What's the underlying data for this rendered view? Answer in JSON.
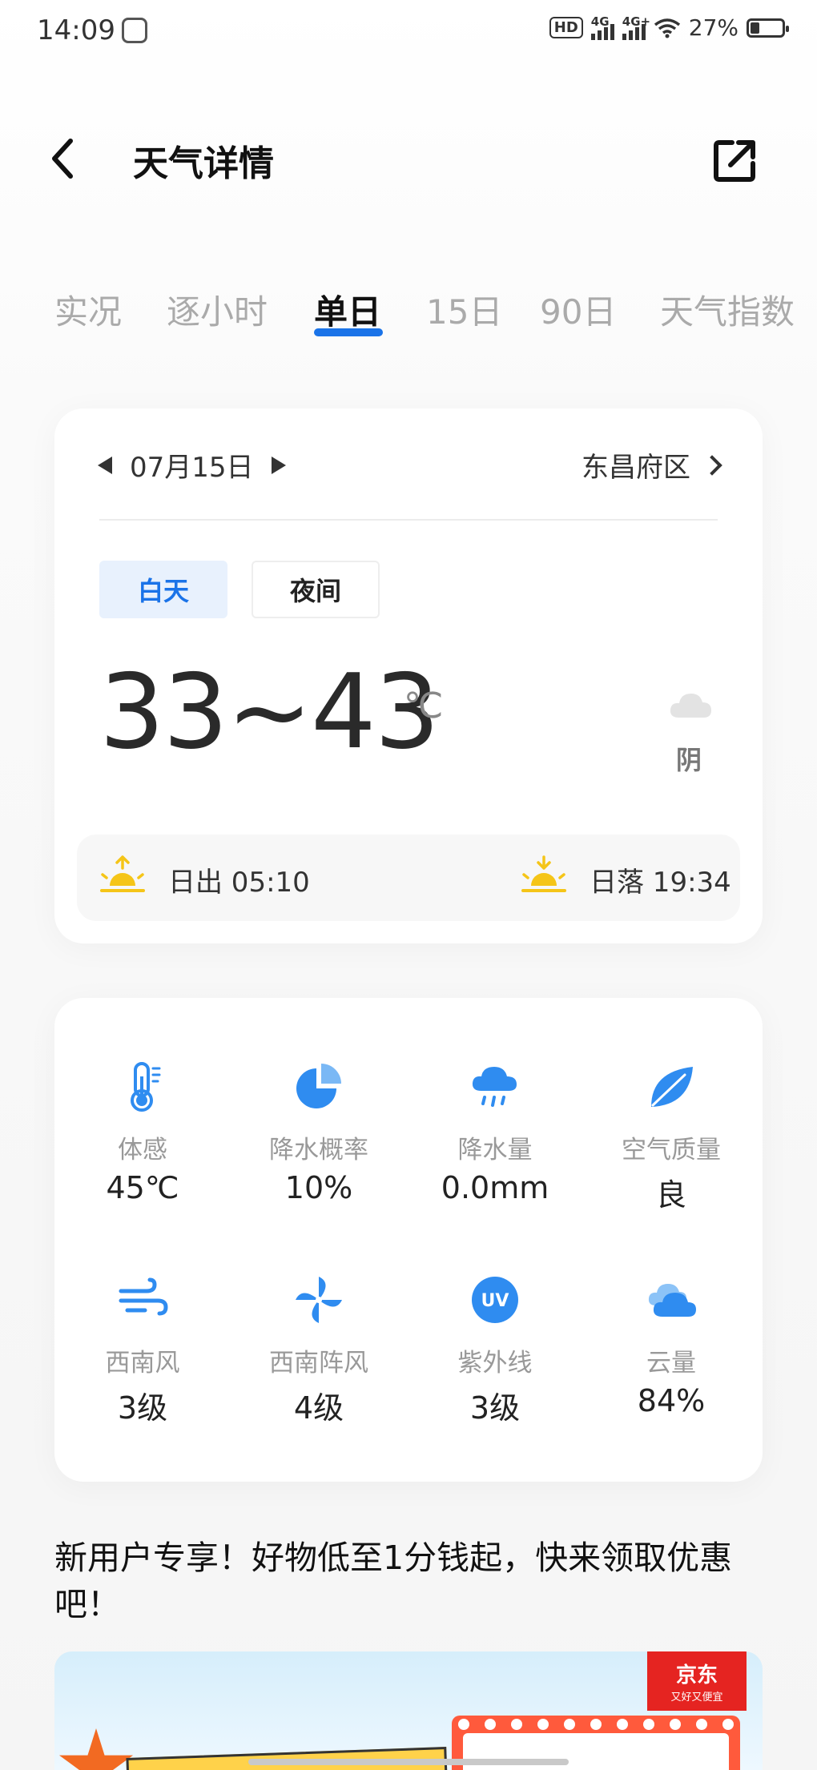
{
  "status_bar": {
    "time": "14:09",
    "hd_badge": "HD",
    "sim1_label": "4G",
    "sim2_label": "4G+",
    "battery_text": "27%",
    "battery_level_percent": 27
  },
  "header": {
    "title": "天气详情",
    "back_icon": "back-arrow-icon",
    "share_icon": "share-external-icon"
  },
  "tabs": [
    {
      "label": "实况",
      "active": false
    },
    {
      "label": "逐小时",
      "active": false
    },
    {
      "label": "单日",
      "active": true
    },
    {
      "label": "15日",
      "active": false
    },
    {
      "label": "90日",
      "active": false
    },
    {
      "label": "天气指数",
      "active": false
    }
  ],
  "day_card": {
    "date": "07月15日",
    "location": "东昌府区",
    "segments": {
      "day": "白天",
      "night": "夜间",
      "selected": "白天"
    },
    "temperature_range": "33~43",
    "unit": "℃",
    "condition": "阴",
    "sunrise_label": "日出 05:10",
    "sunset_label": "日落 19:34"
  },
  "metrics": [
    {
      "icon": "thermometer-icon",
      "label": "体感",
      "value": "45℃"
    },
    {
      "icon": "pie-chart-icon",
      "label": "降水概率",
      "value": "10%"
    },
    {
      "icon": "rain-cloud-icon",
      "label": "降水量",
      "value": "0.0mm"
    },
    {
      "icon": "leaf-icon",
      "label": "空气质量",
      "value": "良"
    },
    {
      "icon": "wind-icon",
      "label": "西南风",
      "value": "3级"
    },
    {
      "icon": "pinwheel-icon",
      "label": "西南阵风",
      "value": "4级"
    },
    {
      "icon": "uv-icon",
      "label": "紫外线",
      "value": "3级"
    },
    {
      "icon": "cloud-icon",
      "label": "云量",
      "value": "84%"
    }
  ],
  "promo": {
    "text": "新用户专享！好物低至1分钱起，快来领取优惠吧！",
    "brand_name": "京东",
    "brand_slogan": "又好又便宜"
  },
  "colors": {
    "accent": "#1a73e8",
    "icon_blue": "#2f8cf0",
    "sun_yellow": "#f5c518",
    "brand_red": "#e52421"
  }
}
